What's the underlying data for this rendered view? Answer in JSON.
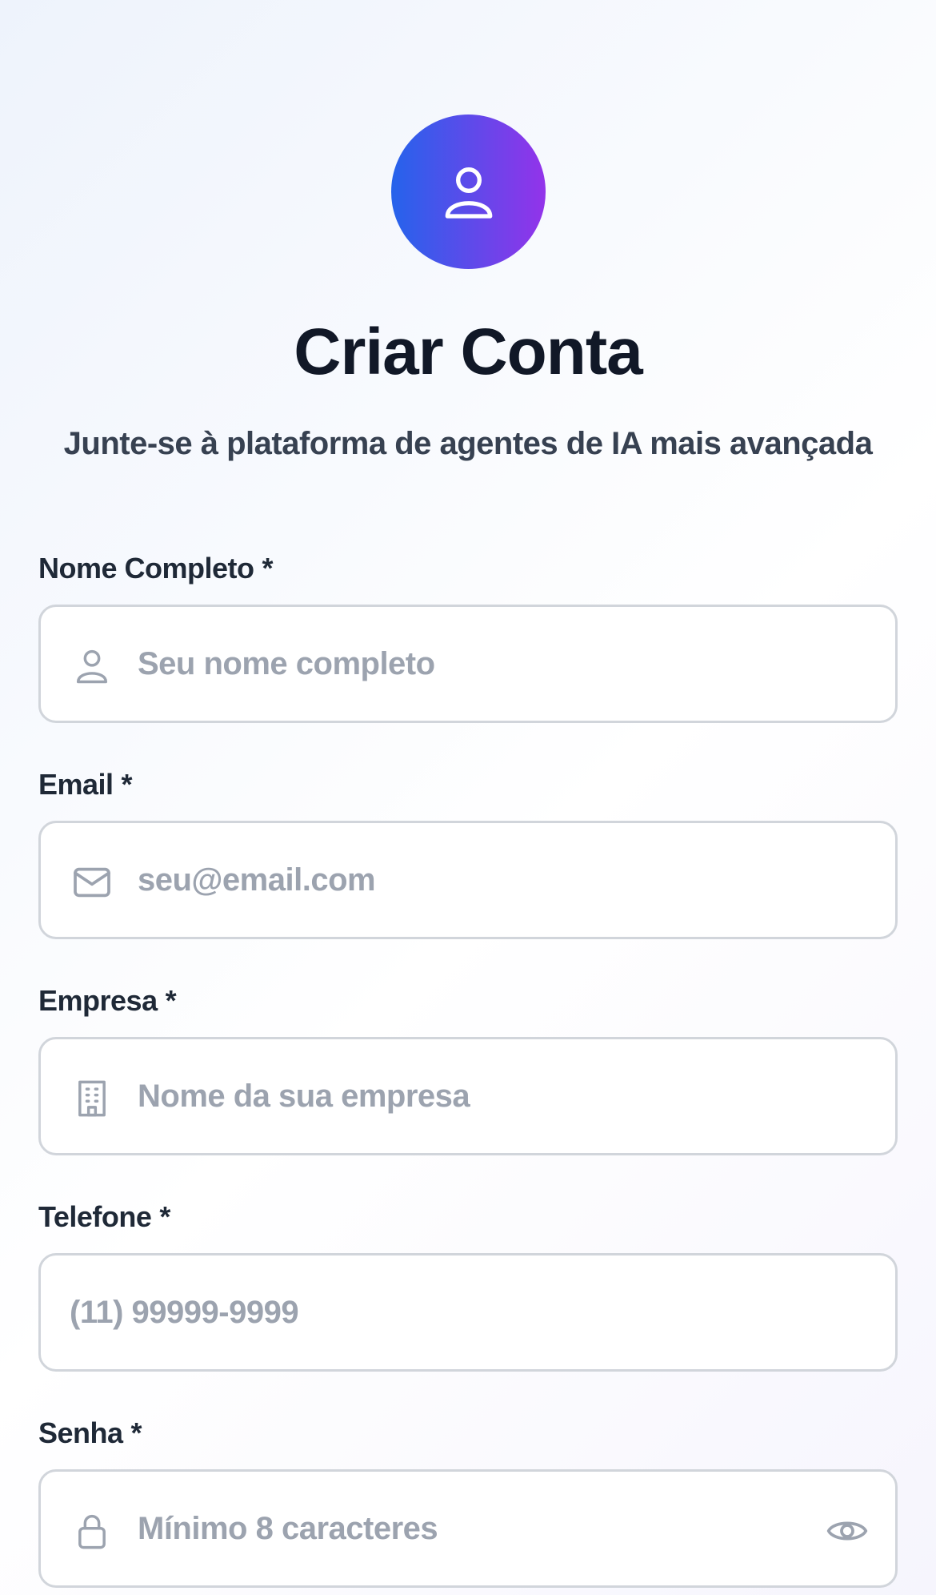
{
  "header": {
    "avatar_icon": "user-icon",
    "title": "Criar Conta",
    "subtitle": "Junte-se à plataforma de agentes de IA mais avançada"
  },
  "colors": {
    "gradient_start": "#2563eb",
    "gradient_end": "#9333ea",
    "title": "#111827",
    "label": "#1f2937",
    "placeholder": "#9ca3af",
    "border": "#d1d5db"
  },
  "form": {
    "name": {
      "label": "Nome Completo",
      "required_mark": "*",
      "placeholder": "Seu nome completo",
      "icon": "user-icon"
    },
    "email": {
      "label": "Email",
      "required_mark": "*",
      "placeholder": "seu@email.com",
      "icon": "mail-icon"
    },
    "company": {
      "label": "Empresa",
      "required_mark": "*",
      "placeholder": "Nome da sua empresa",
      "icon": "building-icon"
    },
    "phone": {
      "label": "Telefone",
      "required_mark": "*",
      "placeholder": "(11) 99999-9999"
    },
    "password": {
      "label": "Senha",
      "required_mark": "*",
      "placeholder": "Mínimo 8 caracteres",
      "icon": "lock-icon",
      "toggle_icon": "eye-icon"
    }
  }
}
